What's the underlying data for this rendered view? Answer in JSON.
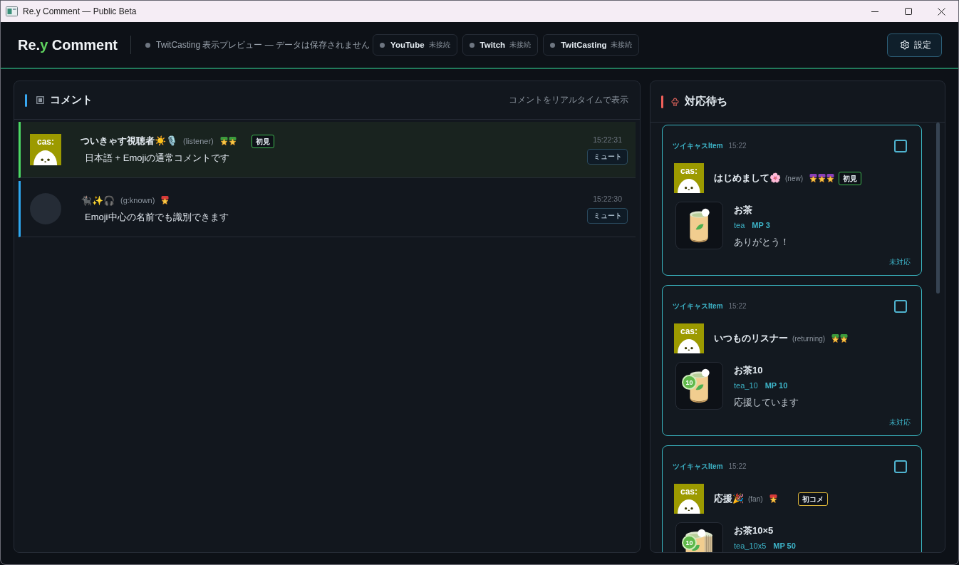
{
  "window": {
    "title": "Re.y Comment — Public Beta"
  },
  "header": {
    "logo": [
      {
        "text": "Re.",
        "accent": false
      },
      {
        "text": "y",
        "accent": true
      },
      {
        "text": " Comment",
        "accent": false
      }
    ],
    "preview_notice": "TwitCasting 表示プレビュー — データは保存されません",
    "platforms": [
      {
        "name": "YouTube",
        "status": "未接続",
        "connected": false
      },
      {
        "name": "Twitch",
        "status": "未接続",
        "connected": false
      },
      {
        "name": "TwitCasting",
        "status": "未接続",
        "connected": false
      }
    ],
    "settings_button": "設定"
  },
  "comments_panel": {
    "title": "コメント",
    "subtitle": "コメントをリアルタイムで表示",
    "comments": [
      {
        "highlighted": true,
        "avatar": {
          "kind": "cas",
          "text": "cas:"
        },
        "name": "ついきゃす視聴者☀️🎙️",
        "tag": "(listener)",
        "member_badges": [
          {
            "color": "#3c9a3c"
          },
          {
            "color": "#3c9a3c"
          }
        ],
        "label": {
          "kind": "first_visit",
          "text": "初見"
        },
        "message": "日本語 + Emojiの通常コメントです",
        "time": "15:22:31",
        "mute_button": "ミュート"
      },
      {
        "highlighted": false,
        "avatar": {
          "kind": "blank"
        },
        "name": "🐈‍⬛✨🎧",
        "tag": "(g:known)",
        "member_badges": [
          {
            "color": "#d63a3a"
          }
        ],
        "message": "Emoji中心の名前でも識別できます",
        "time": "15:22:30",
        "mute_button": "ミュート"
      }
    ]
  },
  "queue_panel": {
    "title": "対応待ち",
    "cards": [
      {
        "source": "ツイキャスItem",
        "time": "15:22",
        "checked": false,
        "avatar": {
          "kind": "cas",
          "text": "cas:"
        },
        "name": "はじめまして🌸",
        "tag": "(new)",
        "member_badges": [
          {
            "color": "#8a3fb8"
          },
          {
            "color": "#8a3fb8"
          },
          {
            "color": "#8a3fb8"
          }
        ],
        "label": {
          "kind": "first_visit",
          "text": "初見"
        },
        "item": {
          "kind": "single",
          "name": "お茶",
          "code": "tea",
          "points": "MP 3"
        },
        "message": "ありがとう！",
        "status": "未対応"
      },
      {
        "source": "ツイキャスItem",
        "time": "15:22",
        "checked": false,
        "avatar": {
          "kind": "cas",
          "text": "cas:"
        },
        "name": "いつものリスナー",
        "tag": "(returning)",
        "member_badges": [
          {
            "color": "#3c9a3c"
          },
          {
            "color": "#3c9a3c"
          }
        ],
        "item": {
          "kind": "single",
          "name": "お茶10",
          "code": "tea_10",
          "points": "MP 10",
          "badge": "10"
        },
        "message": "応援しています",
        "status": "未対応"
      },
      {
        "source": "ツイキャスItem",
        "time": "15:22",
        "checked": false,
        "avatar": {
          "kind": "cas",
          "text": "cas:"
        },
        "name": "応援🎉",
        "tag": "(fan)",
        "member_badges": [
          {
            "color": "#d63a3a"
          }
        ],
        "label": {
          "kind": "first_comment",
          "text": "初コメ"
        },
        "item": {
          "kind": "stack",
          "name": "お茶10×5",
          "code": "tea_10x5",
          "points": "MP 50",
          "badge": "10"
        }
      }
    ]
  }
}
